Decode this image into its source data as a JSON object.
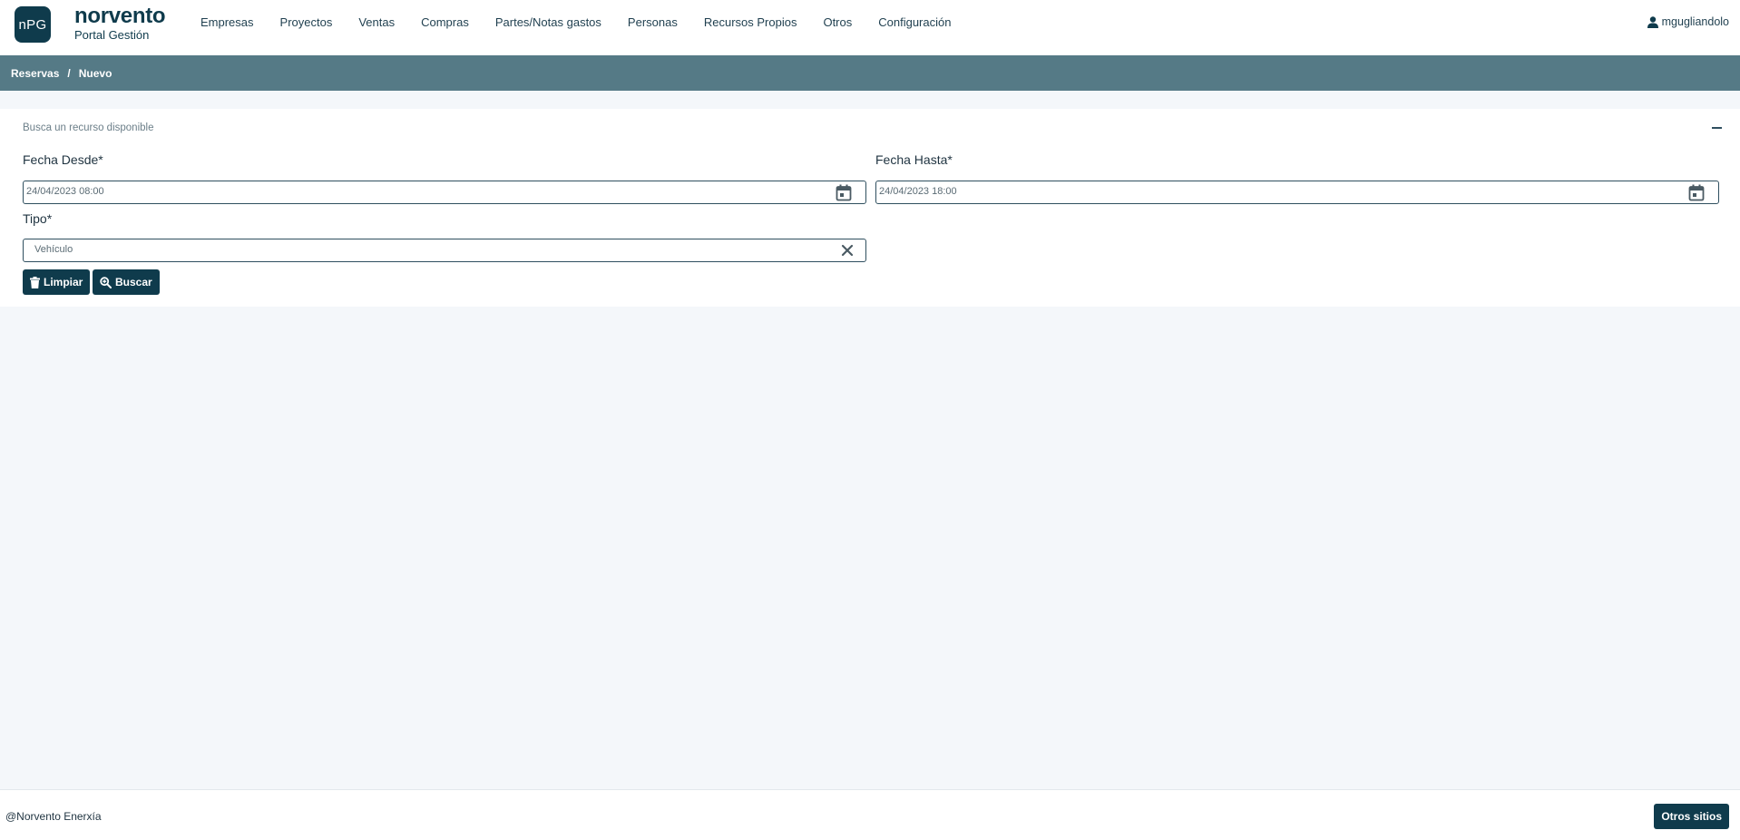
{
  "brand": {
    "logo_text": "nPG",
    "name": "norvento",
    "subtitle": "Portal Gestión"
  },
  "nav": {
    "items": [
      {
        "label": "Empresas"
      },
      {
        "label": "Proyectos"
      },
      {
        "label": "Ventas"
      },
      {
        "label": "Compras"
      },
      {
        "label": "Partes/Notas gastos"
      },
      {
        "label": "Personas"
      },
      {
        "label": "Recursos Propios"
      },
      {
        "label": "Otros"
      },
      {
        "label": "Configuración"
      }
    ]
  },
  "user": {
    "icon": "user-icon",
    "name": "mgugliandolo"
  },
  "breadcrumb": {
    "items": [
      "Reservas",
      "Nuevo"
    ],
    "separator": "/"
  },
  "search_panel": {
    "title": "Busca un recurso disponible",
    "fecha_desde": {
      "label": "Fecha Desde*",
      "value": "24/04/2023 08:00",
      "icon": "calendar-icon"
    },
    "fecha_hasta": {
      "label": "Fecha Hasta*",
      "value": "24/04/2023 18:00",
      "icon": "calendar-icon"
    },
    "tipo": {
      "label": "Tipo*",
      "value": "Vehículo",
      "clear_icon": "close-icon"
    },
    "buttons": {
      "clear": {
        "label": "Limpiar",
        "icon": "trash-icon"
      },
      "search": {
        "label": "Buscar",
        "icon": "search-plus-icon"
      }
    }
  },
  "footer": {
    "copyright": "@Norvento Enerxía",
    "other_sites_label": "Otros sitios"
  },
  "colors": {
    "primary": "#0f3b4c",
    "breadcrumb_bg": "#557a86",
    "page_bg": "#f4f7fa"
  }
}
